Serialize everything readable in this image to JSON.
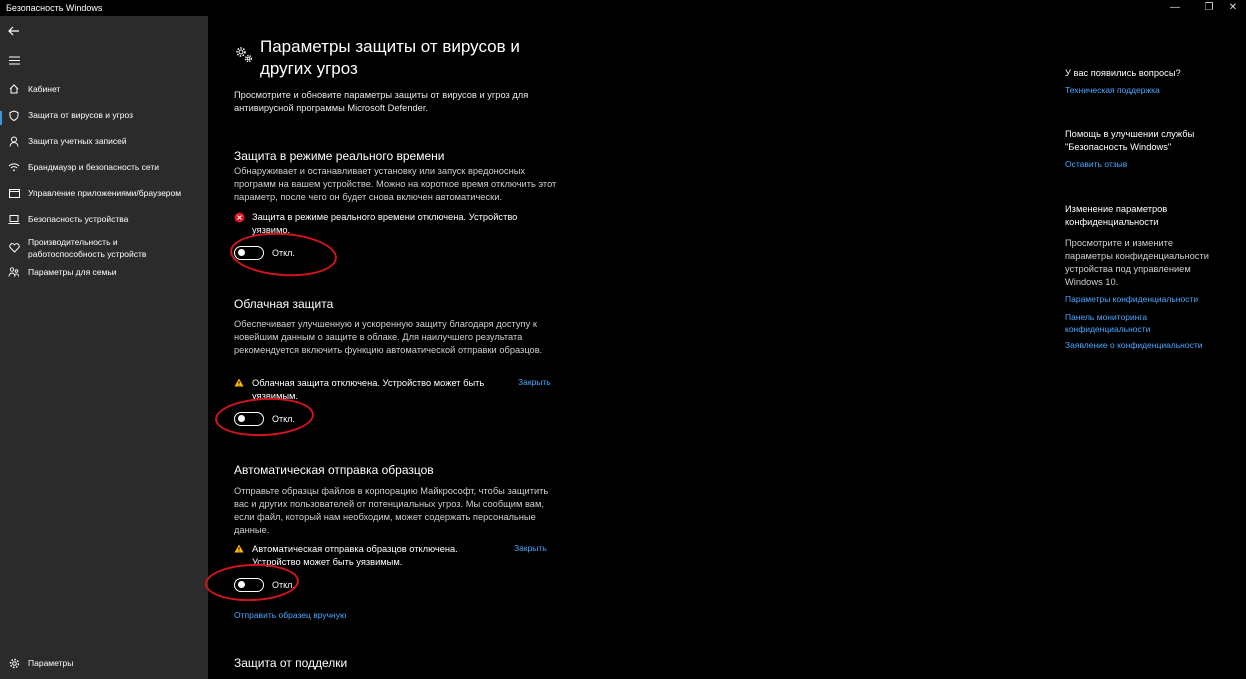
{
  "window": {
    "title": "Безопасность Windows",
    "controls": [
      "—",
      "❐",
      "✕"
    ]
  },
  "sidebar": {
    "back_icon": "back-arrow-icon",
    "menu_icon": "hamburger-icon",
    "items": [
      {
        "label": "Кабинет",
        "icon": "home-icon"
      },
      {
        "label": "Защита от вирусов и угроз",
        "icon": "shield-icon",
        "active": true
      },
      {
        "label": "Защита учетных записей",
        "icon": "person-icon"
      },
      {
        "label": "Брандмауэр и безопасность сети",
        "icon": "wifi-icon"
      },
      {
        "label": "Управление приложениями/браузером",
        "icon": "app-window-icon"
      },
      {
        "label": "Безопасность устройства",
        "icon": "laptop-icon"
      },
      {
        "label": "Производительность и работоспособность устройств",
        "icon": "heart-icon"
      },
      {
        "label": "Параметры для семьи",
        "icon": "family-icon"
      }
    ],
    "settings_label": "Параметры"
  },
  "main": {
    "title": "Параметры защиты от вирусов и других угроз",
    "description": "Просмотрите и обновите параметры защиты от вирусов и угроз для антивирусной программы Microsoft Defender.",
    "sections": [
      {
        "title": "Защита в режиме реального времени",
        "description": "Обнаруживает и останавливает установку или запуск вредоносных программ на вашем устройстве. Можно на короткое время отключить этот параметр, после чего он будет снова включен автоматически.",
        "status": "Защита в режиме реального времени отключена. Устройство уязвимо.",
        "status_icon": "error-x-icon",
        "toggle_label": "Откл."
      },
      {
        "title": "Облачная защита",
        "description": "Обеспечивает улучшенную и ускоренную защиту благодаря доступу к новейшим данным о защите в облаке. Для наилучшего результата рекомендуется включить функцию автоматической отправки образцов.",
        "status": "Облачная защита отключена. Устройство может быть уязвимым.",
        "status_icon": "warning-icon",
        "dismiss": "Закрыть",
        "toggle_label": "Откл."
      },
      {
        "title": "Автоматическая отправка образцов",
        "description": "Отправьте образцы файлов в корпорацию Майкрософт, чтобы защитить вас и других пользователей от потенциальных угроз. Мы сообщим вам, если файл, который нам необходим, может содержать персональные данные.",
        "status": "Автоматическая отправка образцов отключена. Устройство может быть уязвимым.",
        "status_icon": "warning-icon",
        "dismiss": "Закрыть",
        "toggle_label": "Откл.",
        "link": "Отправить образец вручную"
      },
      {
        "title": "Защита от подделки"
      }
    ]
  },
  "right": {
    "questions_head": "У вас появились вопросы?",
    "support_link": "Техническая поддержка",
    "improve_head": "Помощь в улучшении службы \"Безопасность Windows\"",
    "feedback_link": "Оставить отзыв",
    "privacy_head": "Изменение параметров конфиденциальности",
    "privacy_text": "Просмотрите и измените параметры конфиденциальности устройства под управлением Windows 10.",
    "privacy_links": [
      "Параметры конфиденциальности",
      "Панель мониторинга конфиденциальности",
      "Заявление о конфиденциальности"
    ]
  },
  "colors": {
    "sidebar_bg": "#2b2b2b",
    "accent_link": "#4aa6ff",
    "annotation_red": "#d4141c",
    "error_red": "#e81123",
    "warning_yellow": "#ffb900"
  }
}
